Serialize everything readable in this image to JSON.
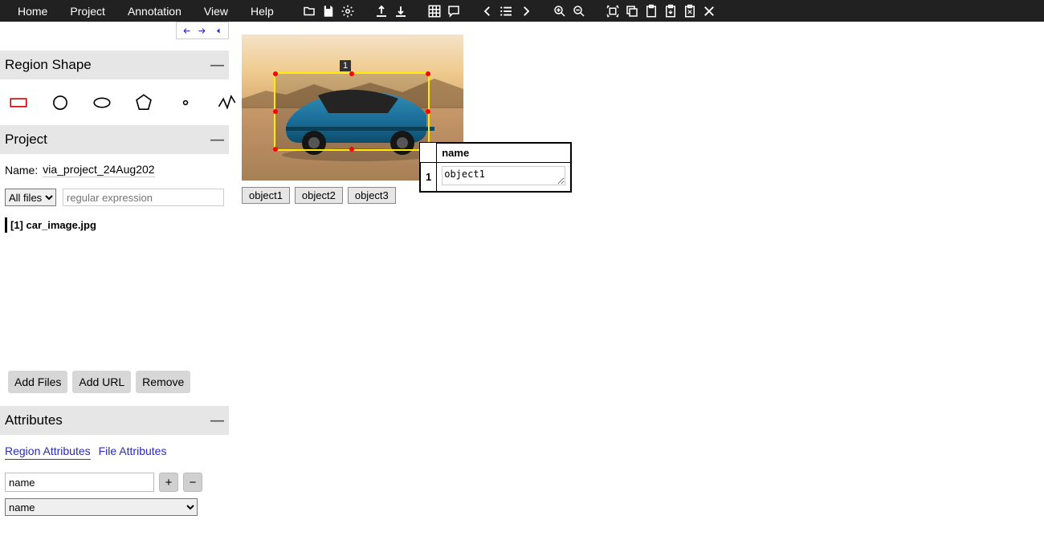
{
  "topMenu": {
    "home": "Home",
    "project": "Project",
    "annotation": "Annotation",
    "view": "View",
    "help": "Help"
  },
  "sidebar": {
    "regionShape": {
      "title": "Region Shape"
    },
    "project": {
      "title": "Project",
      "nameLabel": "Name:",
      "nameValue": "via_project_24Aug202",
      "filterSelected": "All files",
      "regexPlaceholder": "regular expression",
      "files": [
        "[1] car_image.jpg"
      ],
      "addFiles": "Add Files",
      "addUrl": "Add URL",
      "remove": "Remove"
    },
    "attributes": {
      "title": "Attributes",
      "tabRegion": "Region Attributes",
      "tabFile": "File Attributes",
      "attrName": "name",
      "selectValue": "name"
    }
  },
  "canvas": {
    "objButtons": [
      "object1",
      "object2",
      "object3"
    ],
    "regionLabel": "1",
    "popup": {
      "header": "name",
      "rowNum": "1",
      "value": "object1"
    }
  }
}
